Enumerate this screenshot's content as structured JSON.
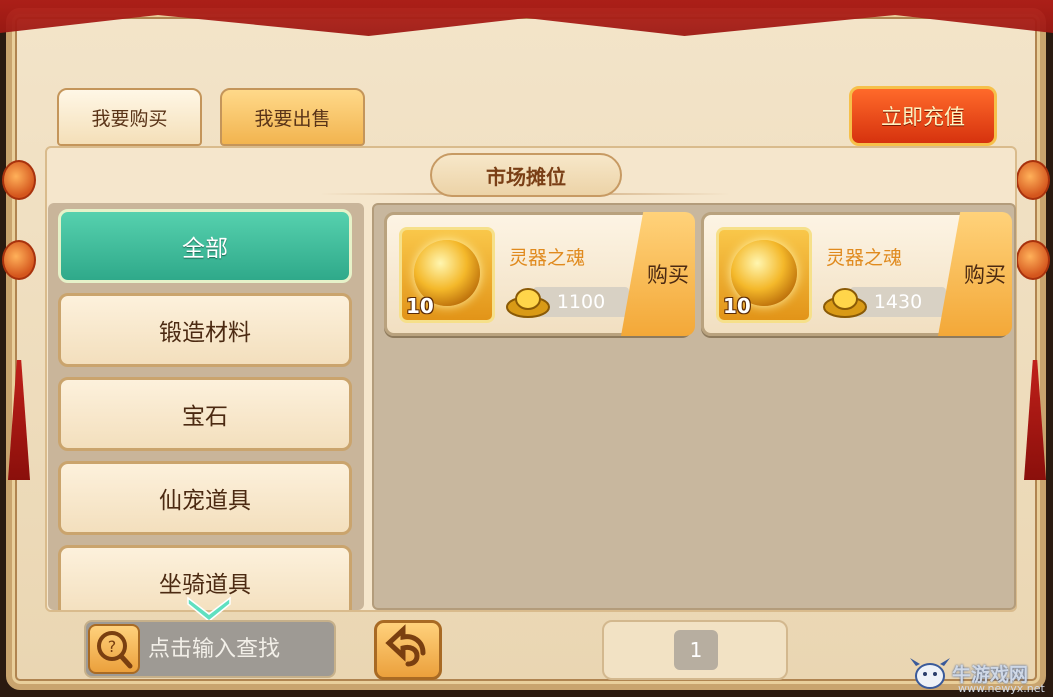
{
  "tabs": {
    "buy_label": "我要购买",
    "sell_label": "我要出售"
  },
  "recharge_label": "立即充值",
  "panel_title": "市场摊位",
  "categories": [
    {
      "label": "全部",
      "active": true
    },
    {
      "label": "锻造材料",
      "active": false
    },
    {
      "label": "宝石",
      "active": false
    },
    {
      "label": "仙宠道具",
      "active": false
    },
    {
      "label": "坐骑道具",
      "active": false
    }
  ],
  "items": [
    {
      "name": "灵器之魂",
      "quantity": "10",
      "price": "1100",
      "buy_label": "购买",
      "icon": "golden-orb-icon"
    },
    {
      "name": "灵器之魂",
      "quantity": "10",
      "price": "1430",
      "buy_label": "购买",
      "icon": "golden-orb-icon"
    }
  ],
  "search": {
    "placeholder": "点击输入查找"
  },
  "pager": {
    "current_page": "1"
  },
  "watermark": {
    "brand": "牛游戏网",
    "url": "www.newyx.net"
  },
  "colors": {
    "active_category": "#2fa98a",
    "recharge": "#d6320e",
    "item_name": "#e08a1e"
  }
}
